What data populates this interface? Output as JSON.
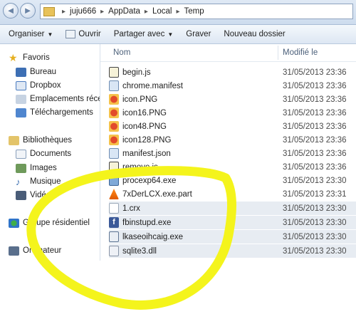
{
  "address": {
    "crumbs": [
      "juju666",
      "AppData",
      "Local",
      "Temp"
    ]
  },
  "toolbar": {
    "organize": "Organiser",
    "open": "Ouvrir",
    "share": "Partager avec",
    "burn": "Graver",
    "new_folder": "Nouveau dossier"
  },
  "nav": {
    "favorites": "Favoris",
    "fav_items": [
      "Bureau",
      "Dropbox",
      "Emplacements récents",
      "Téléchargements"
    ],
    "libraries": "Bibliothèques",
    "lib_items": [
      "Documents",
      "Images",
      "Musique",
      "Vidéos"
    ],
    "homegroup": "Groupe résidentiel",
    "computer": "Ordinateur"
  },
  "columns": {
    "name": "Nom",
    "modified": "Modifié le"
  },
  "files": [
    {
      "name": "begin.js",
      "date": "31/05/2013 23:36",
      "icon": "script-icon"
    },
    {
      "name": "chrome.manifest",
      "date": "31/05/2013 23:36",
      "icon": "manifest-icon"
    },
    {
      "name": "icon.PNG",
      "date": "31/05/2013 23:36",
      "icon": "image-icon"
    },
    {
      "name": "icon16.PNG",
      "date": "31/05/2013 23:36",
      "icon": "image-icon"
    },
    {
      "name": "icon48.PNG",
      "date": "31/05/2013 23:36",
      "icon": "image-icon"
    },
    {
      "name": "icon128.PNG",
      "date": "31/05/2013 23:36",
      "icon": "image-icon"
    },
    {
      "name": "manifest.json",
      "date": "31/05/2013 23:36",
      "icon": "manifest-icon"
    },
    {
      "name": "remove.js",
      "date": "31/05/2013 23:36",
      "icon": "script-icon"
    },
    {
      "name": "procexp64.exe",
      "date": "31/05/2013 23:30",
      "icon": "exe-icon"
    },
    {
      "name": "7xDerLCX.exe.part",
      "date": "31/05/2013 23:31",
      "icon": "vlc-icon"
    },
    {
      "name": "1.crx",
      "date": "31/05/2013 23:30",
      "icon": "blank-file-icon"
    },
    {
      "name": "fbinstupd.exe",
      "date": "31/05/2013 23:30",
      "icon": "facebook-icon"
    },
    {
      "name": "lkaseoihcaig.exe",
      "date": "31/05/2013 23:30",
      "icon": "exe-icon"
    },
    {
      "name": "sqlite3.dll",
      "date": "31/05/2013 23:30",
      "icon": "dll-icon"
    }
  ],
  "colors": {
    "highlighter": "#f4f41c"
  }
}
